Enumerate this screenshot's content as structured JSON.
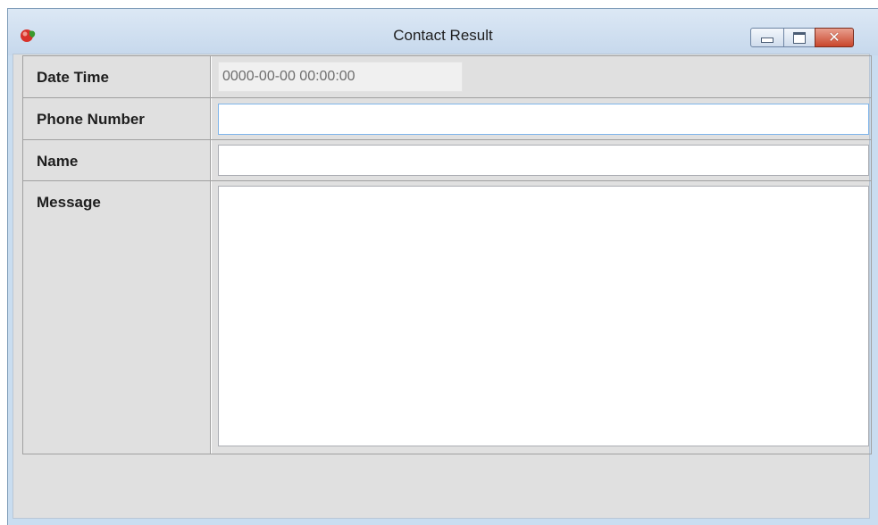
{
  "window": {
    "title": "Contact Result",
    "controls": {
      "minimize_icon": "minimize-icon",
      "maximize_icon": "maximize-icon",
      "close_icon": "close-icon",
      "close_glyph": "✕"
    }
  },
  "form": {
    "date_time": {
      "label": "Date Time",
      "value": "0000-00-00 00:00:00"
    },
    "phone_number": {
      "label": "Phone Number",
      "value": ""
    },
    "name": {
      "label": "Name",
      "value": ""
    },
    "message": {
      "label": "Message",
      "value": ""
    }
  },
  "colors": {
    "titlebar": "#c6d8ec",
    "client_bg": "#e0e0e0",
    "close_button": "#c9462c",
    "focus_border": "#7eb4ea"
  }
}
